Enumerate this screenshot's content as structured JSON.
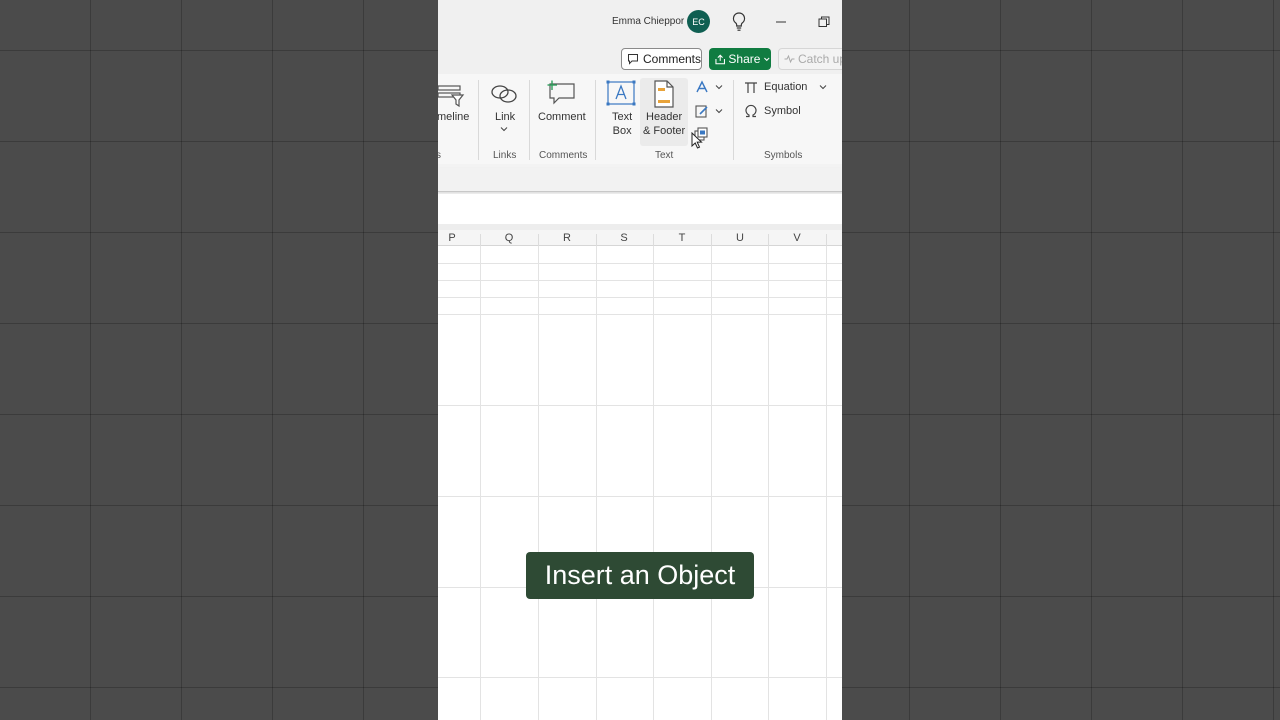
{
  "titlebar": {
    "user_name": "Emma Chieppor",
    "avatar_initials": "EC"
  },
  "cmdbar": {
    "comments_label": "Comments",
    "share_label": "Share",
    "catchup_label": "Catch up"
  },
  "ribbon": {
    "timeline_label": "meline",
    "link_label": "Link",
    "comment_label": "Comment",
    "textbox_line1": "Text",
    "textbox_line2": "Box",
    "header_line1": "Header",
    "header_line2": "& Footer",
    "equation_label": "Equation",
    "symbol_label": "Symbol",
    "groups": {
      "partial": "s",
      "links": "Links",
      "comments": "Comments",
      "text": "Text",
      "symbols": "Symbols"
    }
  },
  "columns": [
    "P",
    "Q",
    "R",
    "S",
    "T",
    "U",
    "V"
  ],
  "caption": "Insert an Object",
  "colors": {
    "accent_green": "#107c41",
    "avatar_bg": "#0f5f52",
    "caption_bg": "#2e4a34"
  }
}
